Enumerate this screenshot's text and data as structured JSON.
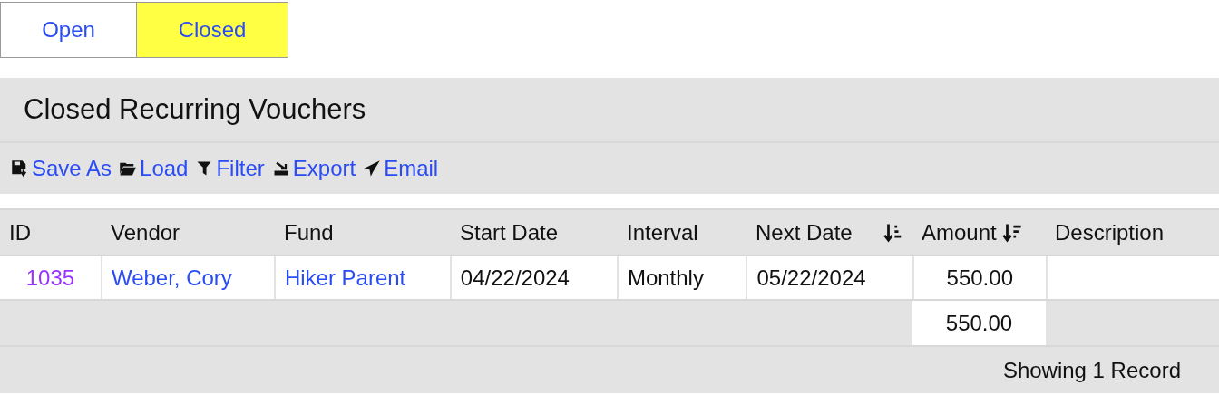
{
  "tabs": [
    {
      "label": "Open",
      "selected": false
    },
    {
      "label": "Closed",
      "selected": true
    }
  ],
  "title": "Closed Recurring Vouchers",
  "toolbar": [
    {
      "kind": "save",
      "label": "Save As"
    },
    {
      "kind": "load",
      "label": "Load"
    },
    {
      "kind": "filter",
      "label": "Filter"
    },
    {
      "kind": "export",
      "label": "Export"
    },
    {
      "kind": "email",
      "label": "Email"
    }
  ],
  "table": {
    "columns": [
      {
        "label": "ID"
      },
      {
        "label": "Vendor"
      },
      {
        "label": "Fund"
      },
      {
        "label": "Start Date"
      },
      {
        "label": "Interval"
      },
      {
        "label": "Next Date",
        "sorted": true,
        "descending": false
      },
      {
        "label": "Amount",
        "sorted": true,
        "descending": true
      },
      {
        "label": "Description"
      }
    ],
    "rows": [
      [
        {
          "kind": "visited",
          "text": "1035"
        },
        {
          "kind": "link",
          "text": "Weber, Cory"
        },
        {
          "kind": "link",
          "text": "Hiker Parent"
        },
        {
          "kind": "text",
          "text": "04/22/2024"
        },
        {
          "kind": "text",
          "text": "Monthly"
        },
        {
          "kind": "text",
          "text": "05/22/2024"
        },
        {
          "kind": "number",
          "text": "550.00"
        },
        {
          "kind": "empty"
        }
      ]
    ],
    "total": "550.00"
  },
  "status": "Showing 1 Record"
}
